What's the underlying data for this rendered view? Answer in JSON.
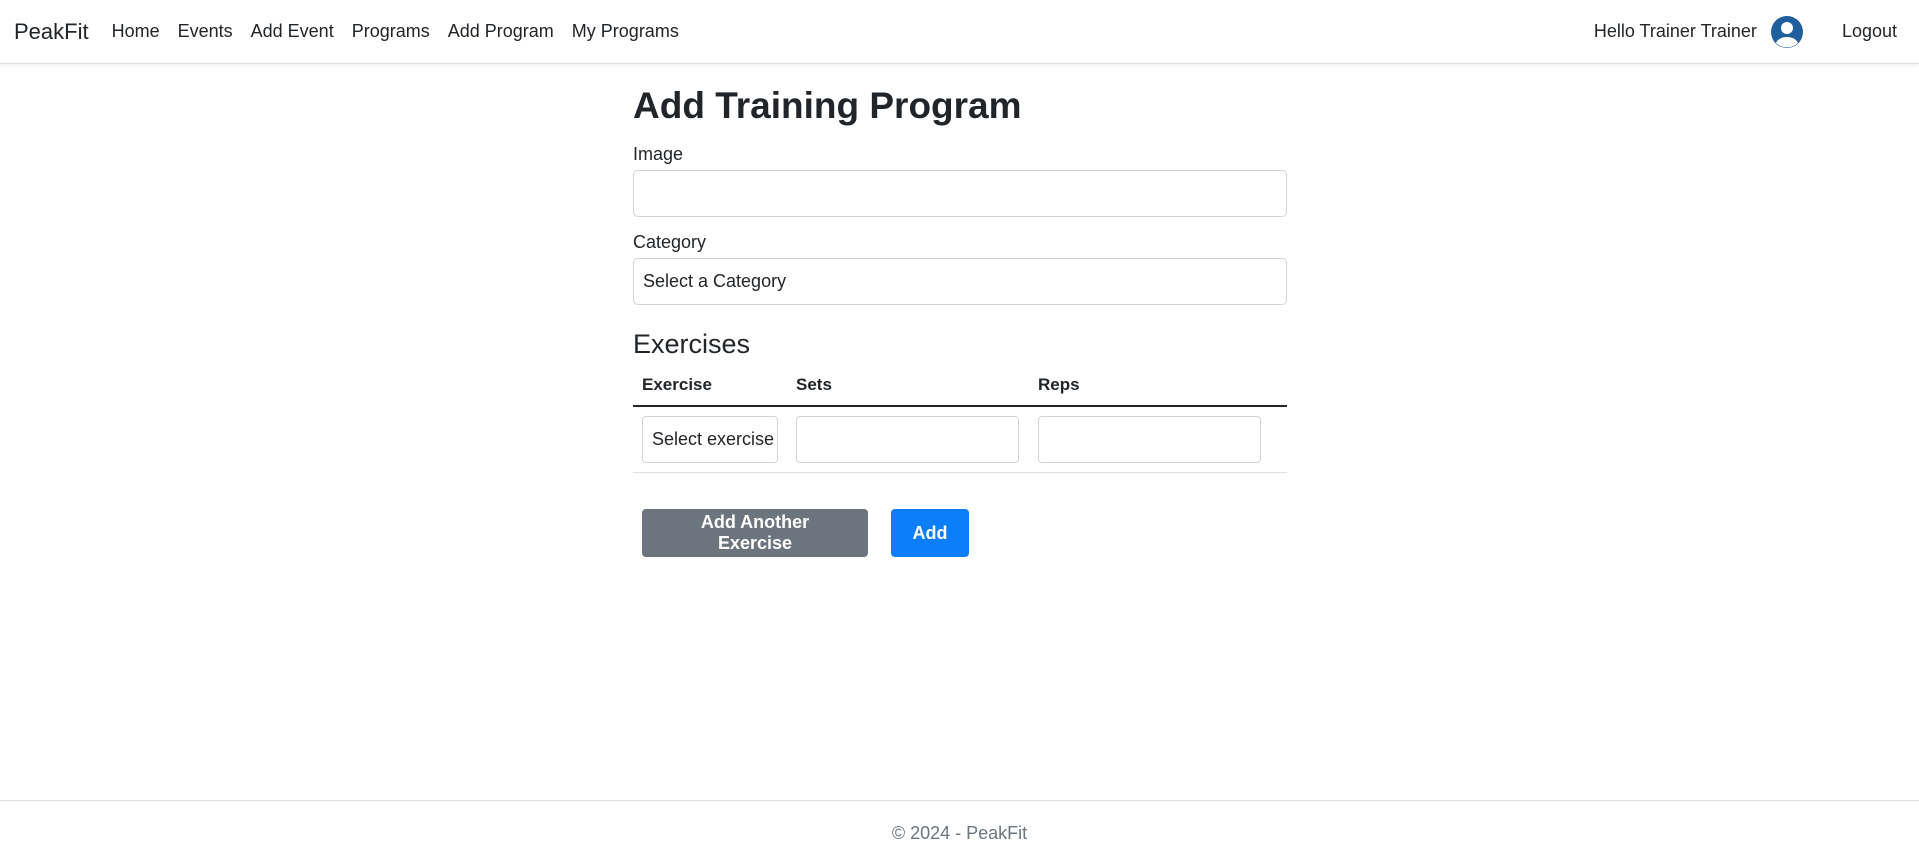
{
  "navbar": {
    "brand": "PeakFit",
    "links": [
      "Home",
      "Events",
      "Add Event",
      "Programs",
      "Add Program",
      "My Programs"
    ],
    "greeting": "Hello Trainer Trainer",
    "logout": "Logout"
  },
  "main": {
    "title": "Add Training Program",
    "image_label": "Image",
    "image_value": "",
    "category_label": "Category",
    "category_selected": "Select a Category",
    "exercises_heading": "Exercises",
    "table": {
      "headers": [
        "Exercise",
        "Sets",
        "Reps"
      ],
      "rows": [
        {
          "exercise": "Select exercise",
          "sets": "",
          "reps": ""
        }
      ]
    },
    "add_another_label": "Add Another Exercise",
    "add_label": "Add"
  },
  "footer": {
    "text": "© 2024 - PeakFit"
  },
  "colors": {
    "primary": "#0d7ef9",
    "secondary": "#6c757d",
    "avatar": "#1f5f9e"
  }
}
